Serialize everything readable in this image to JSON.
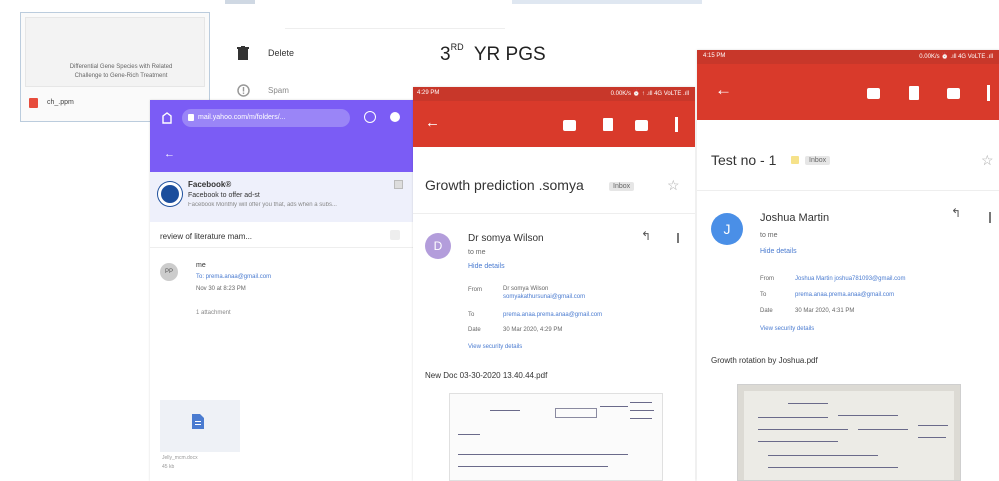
{
  "heading": "3RD YR PGS",
  "heading_main": "3",
  "heading_sup": "RD",
  "heading_rest": "YR PGS",
  "card1": {
    "preview_line1": "Differential Gene Species with Related",
    "preview_line2": "Challenge to Gene-Rich Treatment",
    "file_name": "ch_.ppm"
  },
  "menu": {
    "delete_label": "Delete",
    "spam_label": "Spam"
  },
  "yahoo": {
    "url": "mail.yahoo.com/m/folders/...",
    "facebook_sender": "Facebook®",
    "facebook_subject": "Facebook to offer ad-st",
    "facebook_preview": "Facebook Monthly will offer you that, ads when a subs...",
    "thread_subject": "review of literature mam...",
    "sender_initials": "PP",
    "sender_name": "me",
    "to_line": "To: prema.anaa@gmail.com",
    "date_line": "Nov 30 at 8:23 PM",
    "attachments": "1 attachment",
    "attachment_name": "Jelly_mcm.docx",
    "attachment_size": "45 kb"
  },
  "phone2": {
    "status_time": "4:29 PM",
    "status_right": "0.00K/s ⏰ ↑ .ıll 4G VoLTE .ıll",
    "subject": "Growth prediction .somya",
    "label": "Inbox",
    "sender": "Dr somya Wilson",
    "avatar_letter": "D",
    "to": "to me",
    "hide_details": "Hide details",
    "from_label": "From",
    "from_value_1": "Dr somya Wilson",
    "from_value_2": "somyakathursunai@gmail.com",
    "to_label": "To",
    "to_value": "prema.anaa.prema.anaa@gmail.com",
    "date_label": "Date",
    "date_value": "30 Mar 2020, 4:29 PM",
    "security": "View security details",
    "attachment": "New Doc 03-30-2020 13.40.44.pdf"
  },
  "phone3": {
    "status_time": "4:15 PM",
    "status_right": "0.00K/s ⏰ .ıll 4G VoLTE .ıll",
    "subject": "Test no - 1",
    "label": "Inbox",
    "sender": "Joshua Martin",
    "avatar_letter": "J",
    "to": "to me",
    "hide_details": "Hide details",
    "from_label": "From",
    "from_value": "Joshua Martin joshua781093@gmail.com",
    "to_label": "To",
    "to_value": "prema.anaa.prema.anaa@gmail.com",
    "date_label": "Date",
    "date_value": "30 Mar 2020, 4:31 PM",
    "security": "View security details",
    "attachment": "Growth rotation by Joshua.pdf"
  },
  "colors": {
    "gmail_red": "#d93a2b",
    "yahoo_purple": "#7b5cf5",
    "avatar_purple": "#b39ddb",
    "avatar_blue": "#4a8fe7"
  }
}
